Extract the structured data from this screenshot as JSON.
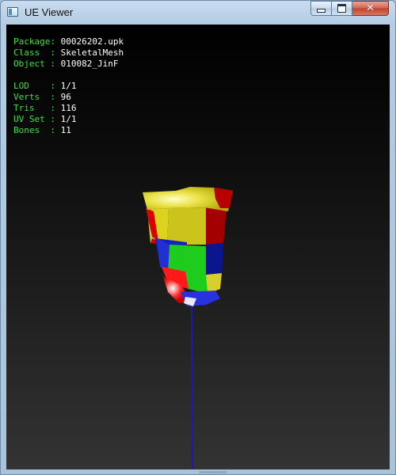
{
  "window": {
    "title": "UE Viewer",
    "close_glyph": "✕"
  },
  "info": {
    "package": {
      "label": "Package: ",
      "value": "00026202.upk"
    },
    "class": {
      "label": "Class  : ",
      "value": "SkeletalMesh"
    },
    "object": {
      "label": "Object : ",
      "value": "010082_JinF"
    },
    "lod": {
      "label": "LOD    : ",
      "value": "1/1"
    },
    "verts": {
      "label": "Verts  : ",
      "value": "96"
    },
    "tris": {
      "label": "Tris   : ",
      "value": "116"
    },
    "uvset": {
      "label": "UV Set : ",
      "value": "1/1"
    },
    "bones": {
      "label": "Bones  : ",
      "value": "11"
    }
  },
  "colors": {
    "label": "#3ee03e",
    "value": "#ffffff",
    "bone_line": "#1c1ca8"
  }
}
